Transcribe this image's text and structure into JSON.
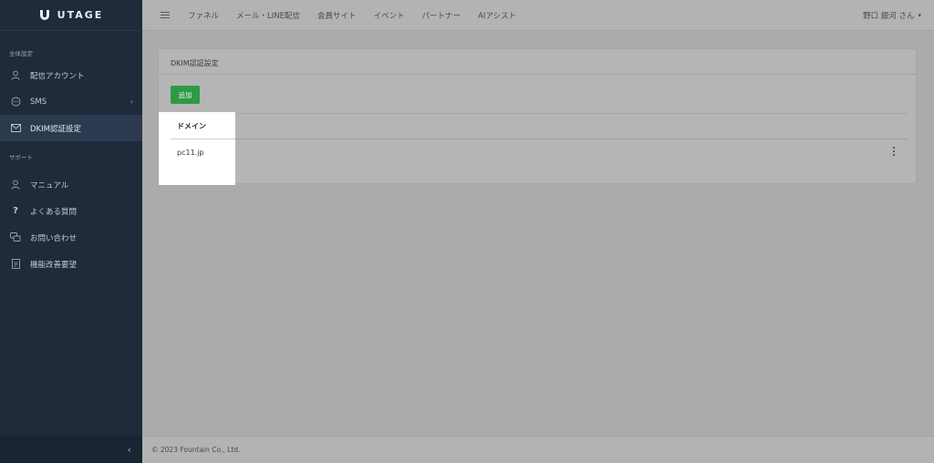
{
  "app": {
    "logo_text": "UTAGE"
  },
  "sidebar": {
    "section1_label": "全体設定",
    "section2_label": "サポート",
    "items": [
      {
        "label": "配信アカウント",
        "icon": "user-icon"
      },
      {
        "label": "SMS",
        "icon": "chat-icon"
      },
      {
        "label": "DKIM認証設定",
        "icon": "mail-icon"
      },
      {
        "label": "マニュアル",
        "icon": "user-icon"
      },
      {
        "label": "よくある質問",
        "icon": "question-icon"
      },
      {
        "label": "お問い合わせ",
        "icon": "chat-bubbles-icon"
      },
      {
        "label": "機能改善要望",
        "icon": "document-icon"
      }
    ],
    "active_item": "DKIM認証設定",
    "sms_caret": "‹",
    "collapse_icon": "‹"
  },
  "topbar": {
    "nav": [
      "ファネル",
      "メール・LINE配信",
      "会員サイト",
      "イベント",
      "パートナー",
      "AIアシスト"
    ],
    "user_name": "野口 銀河 さん",
    "user_caret": "▾"
  },
  "card": {
    "title": "DKIM認証設定",
    "add_button": "追加",
    "table": {
      "headers": [
        "ドメイン"
      ],
      "rows": [
        [
          "pc11.jp"
        ]
      ]
    }
  },
  "footer": {
    "copyright": "© 2023 Fountain Co., Ltd."
  },
  "colors": {
    "sidebar_bg": "#1f2b3b",
    "sidebar_active": "#2b3a4e",
    "add_button": "#2e9a45",
    "overlay": "#ababab"
  }
}
